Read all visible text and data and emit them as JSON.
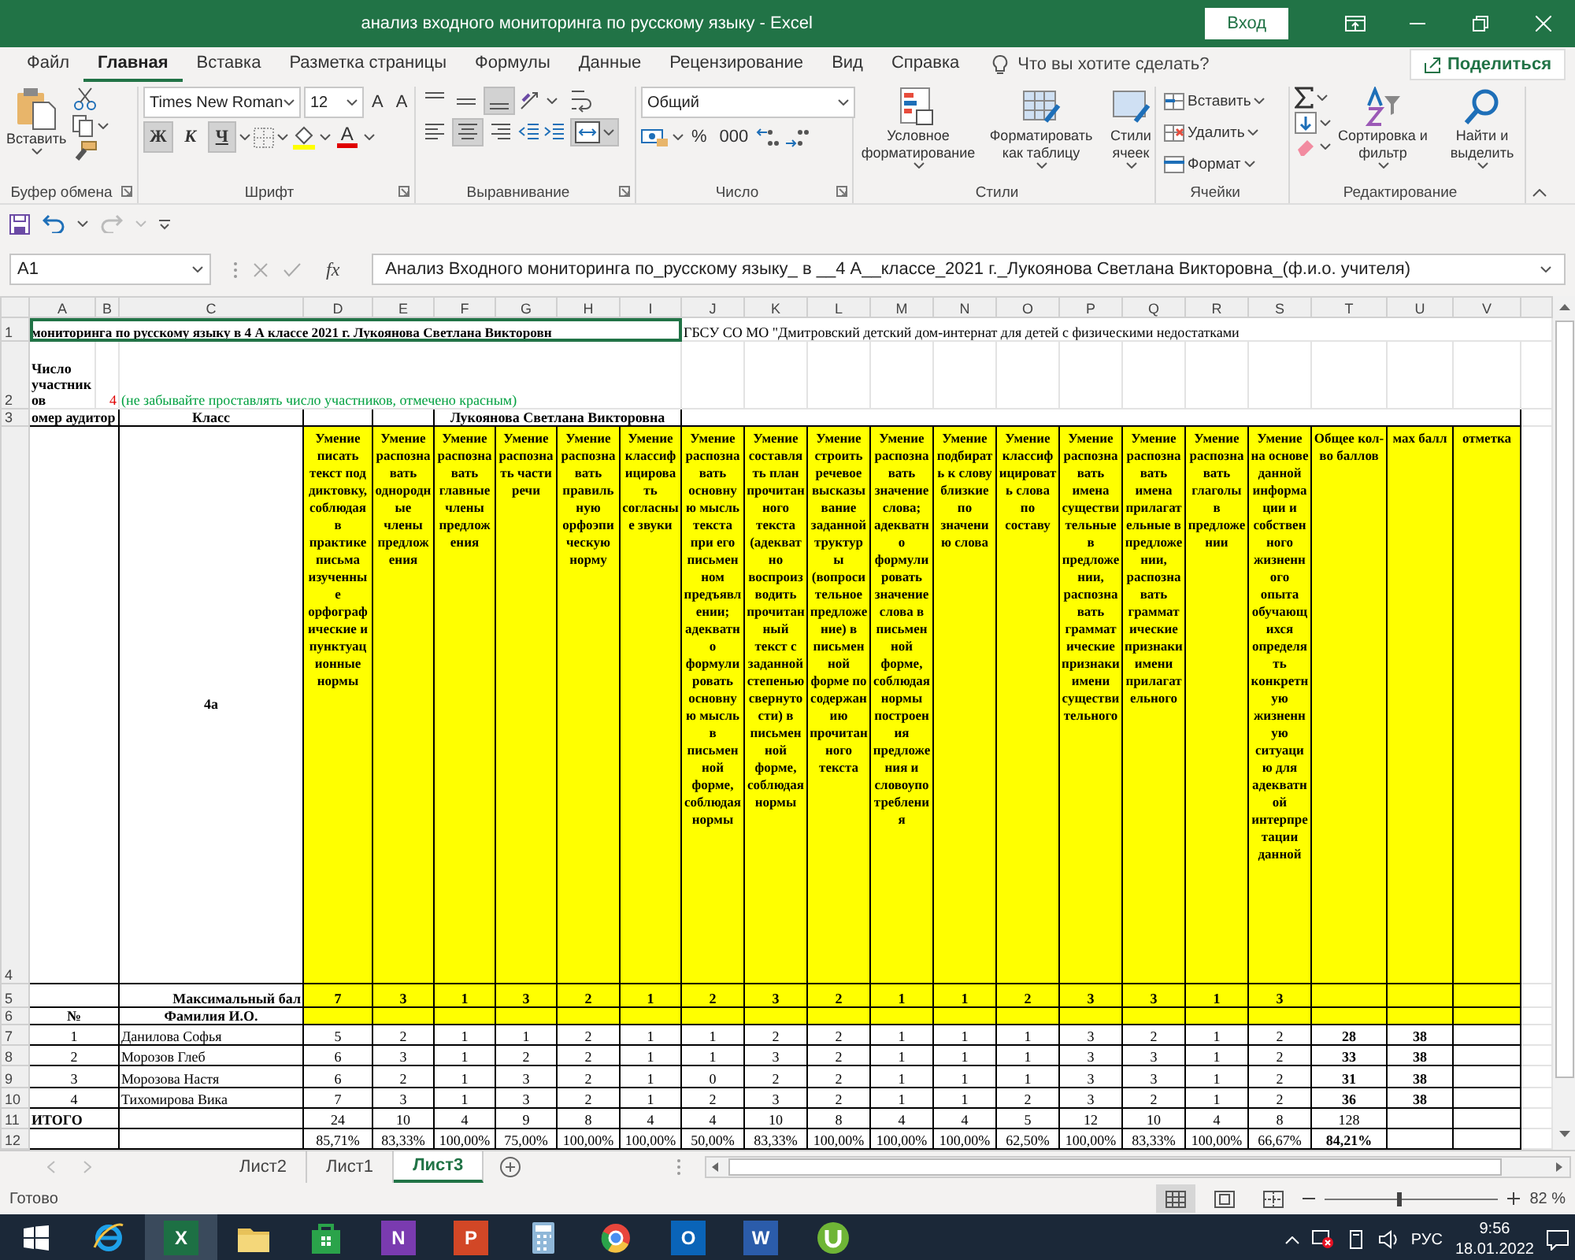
{
  "window": {
    "title": "анализ  входного мониторинга по русскому языку  -  Excel",
    "sign_in": "Вход"
  },
  "menu_tabs": [
    {
      "label": "Файл",
      "selected": false
    },
    {
      "label": "Главная",
      "selected": true
    },
    {
      "label": "Вставка",
      "selected": false
    },
    {
      "label": "Разметка страницы",
      "selected": false
    },
    {
      "label": "Формулы",
      "selected": false
    },
    {
      "label": "Данные",
      "selected": false
    },
    {
      "label": "Рецензирование",
      "selected": false
    },
    {
      "label": "Вид",
      "selected": false
    },
    {
      "label": "Справка",
      "selected": false
    }
  ],
  "tell_me": {
    "placeholder": "Что вы хотите сделать?"
  },
  "share": "Поделиться",
  "ribbon": {
    "clipboard": {
      "paste": "Вставить",
      "label": "Буфер обмена"
    },
    "font": {
      "name": "Times New Roman",
      "size": "12",
      "grow": "A",
      "shrink": "A",
      "bold": "Ж",
      "italic": "К",
      "underline": "Ч",
      "underline_on": true,
      "color_letter": "A",
      "label": "Шрифт"
    },
    "alignment": {
      "label": "Выравнивание"
    },
    "number": {
      "format": "Общий",
      "percent": "%",
      "thousands": "000",
      "label": "Число"
    },
    "styles": {
      "buttons": [
        "Условное форматирование",
        "Форматировать как таблицу",
        "Стили ячеек"
      ],
      "label": "Стили"
    },
    "cells": {
      "buttons": [
        "Вставить",
        "Удалить",
        "Формат"
      ],
      "label": "Ячейки"
    },
    "editing": {
      "buttons": [
        "Сортировка и фильтр",
        "Найти и выделить"
      ],
      "label": "Редактирование"
    }
  },
  "formula_bar": {
    "name_box": "A1",
    "fx": "fx",
    "formula": "Анализ Входного мониторинга по_русскому языку_ в __4 А__классе_2021 г._Лукоянова Светлана Викторовна_(ф.и.о. учителя)"
  },
  "sheet": {
    "columns": [
      "A",
      "B",
      "C",
      "D",
      "E",
      "F",
      "G",
      "H",
      "I",
      "J",
      "K",
      "L",
      "M",
      "N",
      "O",
      "P",
      "Q",
      "R",
      "S",
      "T",
      "U",
      "V"
    ],
    "row_numbers": [
      "1",
      "2",
      "3",
      "4",
      "5",
      "6",
      "7",
      "8",
      "9",
      "10",
      "11",
      "12"
    ],
    "title": "мониторинга по  русскому языку   в     4 А    классе  2021 г.  Лукоянова Светлана Викторовн",
    "title_selected": true,
    "institution": "ГБСУ СО МО \"Дмитровский детский дом-интернат для детей с физическими недостатками",
    "participants_label": "Число участников",
    "participants_count": "4",
    "participants_note": "(не забывайте проставлять число участников, отмечено красным)",
    "room_label": "омер аудитор",
    "class_label": "Класс",
    "teacher": "Лукоянова Светлана Викторовна",
    "class_name": "4а",
    "skills": [
      "Умение писать текст под диктовку, соблюдая в практике письма изученные орфографические и пунктуационные нормы",
      "Умение распознавать однородные члены предложения",
      "Умение распознавать главные члены предложения",
      "Умение распознать части речи",
      "Умение распознавать правильную орфоэпическую норму",
      "Умение классифицировать согласные звуки",
      "Умение распознавать основную мысль текста при его письменном предъявлении; адекватно формулировать основную мысль в письменной форме, соблюдая нормы",
      "Умение составлять план прочитанного текста (адекватно воспроизводить прочитанный текст с заданной степенью свернутости) в письменной форме, соблюдая нормы",
      "Умение строить речевое высказывание заданной труктуры (вопросительное предложение) в письменной форме по содержанию прочитанного текста",
      "Умение распознавать значение слова; адекватно формулировать значение слова в письменной форме, соблюдая нормы построения предложения и словоупотребления",
      "Умение подбирать к слову близкие по значению слова",
      "Умение классифицировать слова по составу",
      "Умение распознавать имена существительные в предложении, распознавать грамматические признаки имени существительного",
      "Умение распознавать имена прилагательные в предложении, распознавать грамматические признаки имени прилагательного",
      "Умение распознавать глаголы в предложении",
      "Умение на основе данной информации и собственного жизненного опыта обучающихся определять конкретную жизненную ситуацию для адекватной интерпретации данной"
    ],
    "total_heading": "Общее кол-во баллов",
    "max_heading": "мах балл",
    "grade_heading": "отметка",
    "max_label": "Максимальный  бал",
    "max_points": [
      "7",
      "3",
      "1",
      "3",
      "2",
      "1",
      "2",
      "3",
      "2",
      "1",
      "1",
      "2",
      "3",
      "3",
      "1",
      "3"
    ],
    "number_heading": "№",
    "name_heading": "Фамилия И.О.",
    "students": [
      {
        "number": "1",
        "name": "Данилова Софья",
        "scores": [
          "5",
          "2",
          "1",
          "1",
          "2",
          "1",
          "1",
          "2",
          "2",
          "1",
          "1",
          "1",
          "3",
          "2",
          "1",
          "2"
        ],
        "total": "28",
        "max": "38"
      },
      {
        "number": "2",
        "name": "Морозов Глеб",
        "scores": [
          "6",
          "3",
          "1",
          "2",
          "2",
          "1",
          "1",
          "3",
          "2",
          "1",
          "1",
          "1",
          "3",
          "3",
          "1",
          "2"
        ],
        "total": "33",
        "max": "38"
      },
      {
        "number": "3",
        "name": "Морозова Настя",
        "scores": [
          "6",
          "2",
          "1",
          "3",
          "2",
          "1",
          "0",
          "2",
          "2",
          "1",
          "1",
          "1",
          "3",
          "3",
          "1",
          "2"
        ],
        "total": "31",
        "max": "38"
      },
      {
        "number": "4",
        "name": "Тихомирова Вика",
        "scores": [
          "7",
          "3",
          "1",
          "3",
          "2",
          "1",
          "2",
          "3",
          "2",
          "1",
          "1",
          "2",
          "3",
          "2",
          "1",
          "2"
        ],
        "total": "36",
        "max": "38"
      }
    ],
    "totals_label": "ИТОГО",
    "sums": [
      "24",
      "10",
      "4",
      "9",
      "8",
      "4",
      "4",
      "10",
      "8",
      "4",
      "4",
      "5",
      "12",
      "10",
      "4",
      "8"
    ],
    "sum_total": "128",
    "percents": [
      "85,71%",
      "83,33%",
      "100,00%",
      "75,00%",
      "100,00%",
      "100,00%",
      "50,00%",
      "83,33%",
      "100,00%",
      "100,00%",
      "100,00%",
      "62,50%",
      "100,00%",
      "83,33%",
      "100,00%",
      "66,67%"
    ],
    "percent_total": "84,21%"
  },
  "sheet_tabs": [
    {
      "label": "Лист2",
      "selected": false
    },
    {
      "label": "Лист1",
      "selected": false
    },
    {
      "label": "Лист3",
      "selected": true
    }
  ],
  "status_bar": {
    "status": "Готово",
    "zoom": "82 %",
    "zoom_slider": {
      "level": 0.42
    }
  },
  "taskbar": {
    "apps": [
      {
        "kind": "ie",
        "active": false
      },
      {
        "kind": "excel",
        "letter": "X",
        "active": true
      },
      {
        "kind": "explorer",
        "active": false
      },
      {
        "kind": "store",
        "active": false
      },
      {
        "kind": "onenote",
        "letter": "N",
        "active": false
      },
      {
        "kind": "powerpoint",
        "letter": "P",
        "active": false
      },
      {
        "kind": "calculator",
        "active": false
      },
      {
        "kind": "chrome",
        "active": false
      },
      {
        "kind": "outlook",
        "letter": "O",
        "active": false
      },
      {
        "kind": "word",
        "letter": "W",
        "active": false
      },
      {
        "kind": "utorrent",
        "active": false
      }
    ],
    "language": "РУС",
    "time": "9:56",
    "date": "18.01.2022"
  }
}
